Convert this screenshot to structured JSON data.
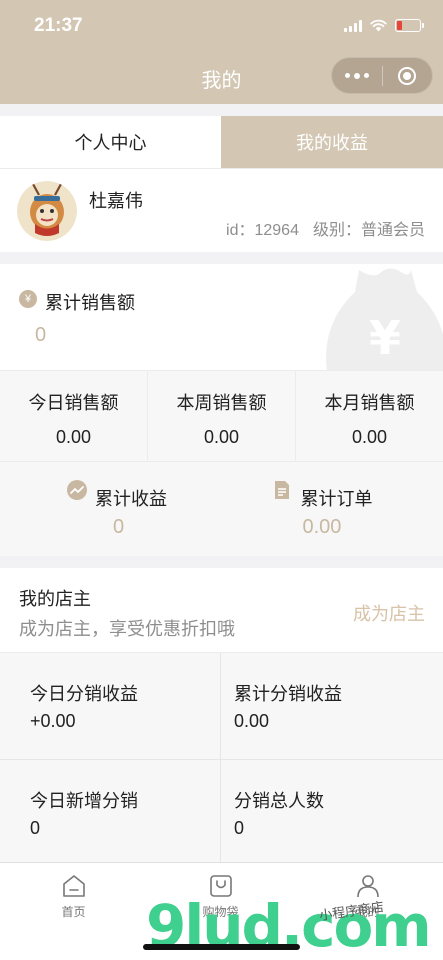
{
  "status_bar": {
    "time": "21:37"
  },
  "nav": {
    "title": "我的"
  },
  "tabs": [
    {
      "label": "个人中心",
      "active": true
    },
    {
      "label": "我的收益",
      "active": false
    }
  ],
  "profile": {
    "name": "杜嘉伟",
    "id_text": "id：12964",
    "level_text": "级别：普通会员"
  },
  "sales": {
    "label": "累计销售额",
    "value": "0",
    "currency_icon": "¥"
  },
  "periods": [
    {
      "label": "今日销售额",
      "value": "0.00"
    },
    {
      "label": "本周销售额",
      "value": "0.00"
    },
    {
      "label": "本月销售额",
      "value": "0.00"
    }
  ],
  "totals": [
    {
      "label": "累计收益",
      "value": "0",
      "icon": "trend-icon"
    },
    {
      "label": "累计订单",
      "value": "0.00",
      "icon": "document-icon"
    }
  ],
  "owner": {
    "title": "我的店主",
    "subtitle": "成为店主，享受优惠折扣哦",
    "action": "成为店主"
  },
  "distribution": [
    {
      "label": "今日分销收益",
      "value": "+0.00"
    },
    {
      "label": "累计分销收益",
      "value": "0.00"
    },
    {
      "label": "今日新增分销",
      "value": "0"
    },
    {
      "label": "分销总人数",
      "value": "0"
    }
  ],
  "tabbar": [
    {
      "label": "首页",
      "icon": "home-icon"
    },
    {
      "label": "购物袋",
      "icon": "bag-icon"
    },
    {
      "label": "我的",
      "icon": "user-icon"
    }
  ],
  "watermark": {
    "brand": "9lud.com",
    "tagline": "小程序商店"
  },
  "colors": {
    "header": "#d3c6b3",
    "accent": "#c8b8a2",
    "owner_action": "#d8c3a8",
    "battery_low": "#e8443a"
  }
}
